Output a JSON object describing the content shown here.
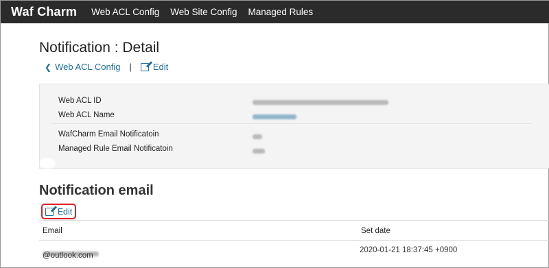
{
  "navbar": {
    "brand": "Waf Charm",
    "items": [
      "Web ACL Config",
      "Web Site Config",
      "Managed Rules"
    ]
  },
  "page": {
    "title": "Notification : Detail",
    "back_link": "Web ACL Config",
    "separator": "|",
    "edit_link": "Edit"
  },
  "panel": {
    "rows": [
      {
        "label": "Web ACL ID"
      },
      {
        "label": "Web ACL Name"
      },
      {
        "label": "WafCharm Email Notificatoin"
      },
      {
        "label": "Managed Rule Email Notificatoin"
      }
    ]
  },
  "section": {
    "title": "Notification email",
    "edit_button": "Edit"
  },
  "table": {
    "columns": [
      "Email",
      "Set date"
    ],
    "rows": [
      {
        "email_visible": "@outlook.com",
        "set_date": "2020-01-21 18:37:45 +0900"
      }
    ]
  }
}
